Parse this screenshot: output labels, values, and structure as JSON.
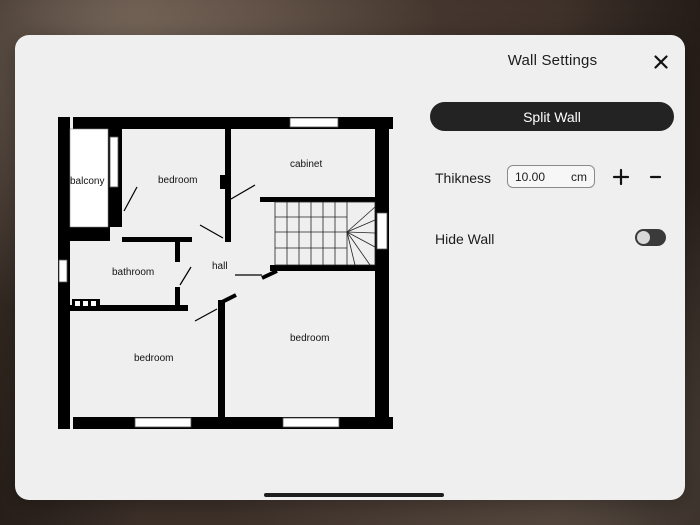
{
  "panel": {
    "title": "Wall Settings",
    "close_icon": "close-icon"
  },
  "actions": {
    "split_wall_label": "Split Wall"
  },
  "thickness": {
    "label": "Thikness",
    "value": "10.00",
    "unit": "cm",
    "increase_icon": "plus-icon",
    "decrease_icon": "minus-icon"
  },
  "hide_wall": {
    "label": "Hide Wall",
    "enabled": false
  },
  "floorplan": {
    "rooms": {
      "balcony": "balcony",
      "bedroom_top": "bedroom",
      "cabinet": "cabinet",
      "hall": "hall",
      "bathroom": "bathroom",
      "bedroom_bottom_left": "bedroom",
      "bedroom_bottom_right": "bedroom"
    }
  },
  "colors": {
    "panel_bg": "#efefef",
    "button_dark": "#232323",
    "wall": "#000000"
  }
}
